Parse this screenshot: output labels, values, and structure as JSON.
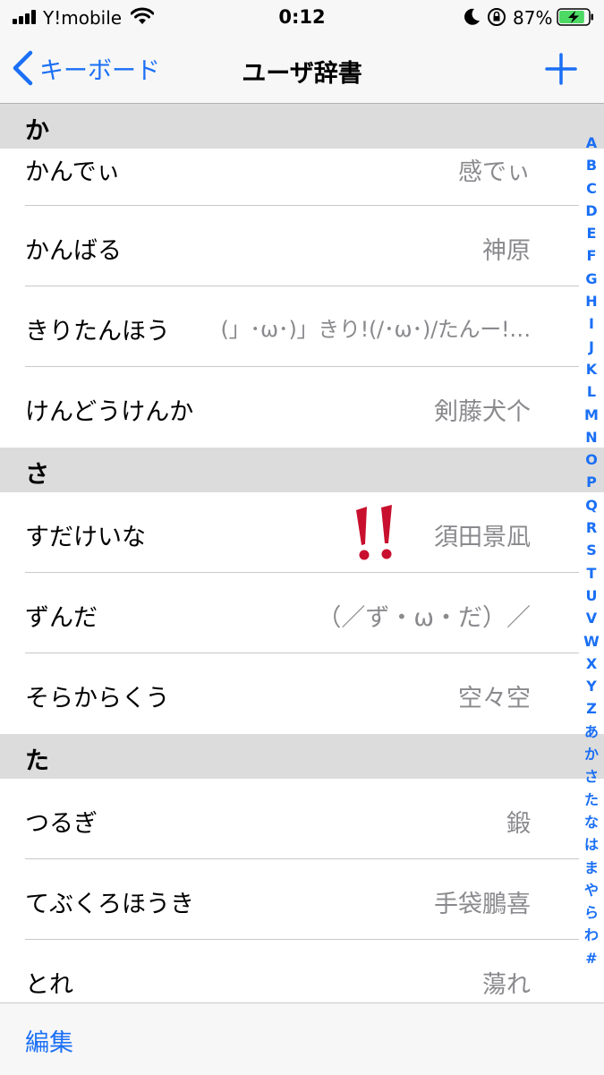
{
  "status": {
    "carrier": "Y!mobile",
    "time": "0:12",
    "battery_percent": "87%",
    "battery_level": 0.87,
    "icons": [
      "signal-icon",
      "wifi-icon",
      "moon-icon",
      "rotation-lock-icon",
      "battery-charging-icon"
    ]
  },
  "nav": {
    "back_label": "キーボード",
    "title": "ユーザ辞書",
    "add_icon": "plus-icon",
    "back_icon": "chevron-left-icon"
  },
  "sections": [
    {
      "header": "か",
      "rows": [
        {
          "reading": "かんでぃ",
          "word": "感でぃ"
        },
        {
          "reading": "かんばる",
          "word": "神原"
        },
        {
          "reading": "きりたんほう",
          "word": "(」･ω･)」きり!(/･ω･)/たんー!…"
        },
        {
          "reading": "けんどうけんか",
          "word": "剣藤犬个"
        }
      ]
    },
    {
      "header": "さ",
      "rows": [
        {
          "reading": "すだけいな",
          "word": "須田景凪"
        },
        {
          "reading": "ずんだ",
          "word": "（／ず・ω・だ）／"
        },
        {
          "reading": "そらからくう",
          "word": "空々空"
        }
      ]
    },
    {
      "header": "た",
      "rows": [
        {
          "reading": "つるぎ",
          "word": "鍛"
        },
        {
          "reading": "てぶくろほうき",
          "word": "手袋鵬喜"
        },
        {
          "reading": "とれ",
          "word": "蕩れ"
        }
      ]
    }
  ],
  "index": [
    "A",
    "B",
    "C",
    "D",
    "E",
    "F",
    "G",
    "H",
    "I",
    "J",
    "K",
    "L",
    "M",
    "N",
    "O",
    "P",
    "Q",
    "R",
    "S",
    "T",
    "U",
    "V",
    "W",
    "X",
    "Y",
    "Z",
    "あ",
    "か",
    "さ",
    "た",
    "な",
    "は",
    "ま",
    "や",
    "ら",
    "わ",
    "#"
  ],
  "toolbar": {
    "edit_label": "編集"
  },
  "colors": {
    "accent": "#1a6ff5",
    "section_bg": "#dcdcdc",
    "secondary_text": "#8a8a8e",
    "battery_green": "#4cd964",
    "annotation_red": "#c8102e"
  }
}
